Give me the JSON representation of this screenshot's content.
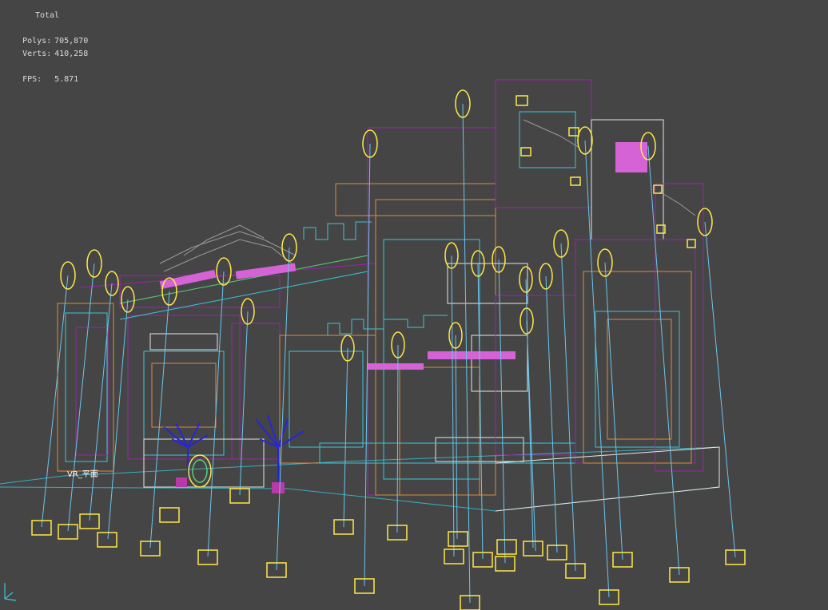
{
  "viewport": {
    "stats": {
      "title": "Total",
      "polys_label": "Polys:",
      "polys_value": "705,870",
      "verts_label": "Verts:",
      "verts_value": "410,258",
      "fps_label": "FPS:",
      "fps_value": "5.871"
    },
    "object_label": "VR_平面",
    "background_color": "#454545",
    "colors": {
      "wire_purple": "#a21fb2",
      "wire_cyan": "#39c7d8",
      "wire_orange": "#e08a3a",
      "wire_green": "#59d07a",
      "wire_white": "#e8e8e8",
      "light_yellow": "#ffe84a",
      "light_line": "#6ac6ef",
      "plant_blue": "#2626d8",
      "sign_pink": "#d663d6"
    },
    "icons": [
      "axis-gizmo-icon",
      "light-bulb-icon",
      "light-target-icon"
    ]
  }
}
